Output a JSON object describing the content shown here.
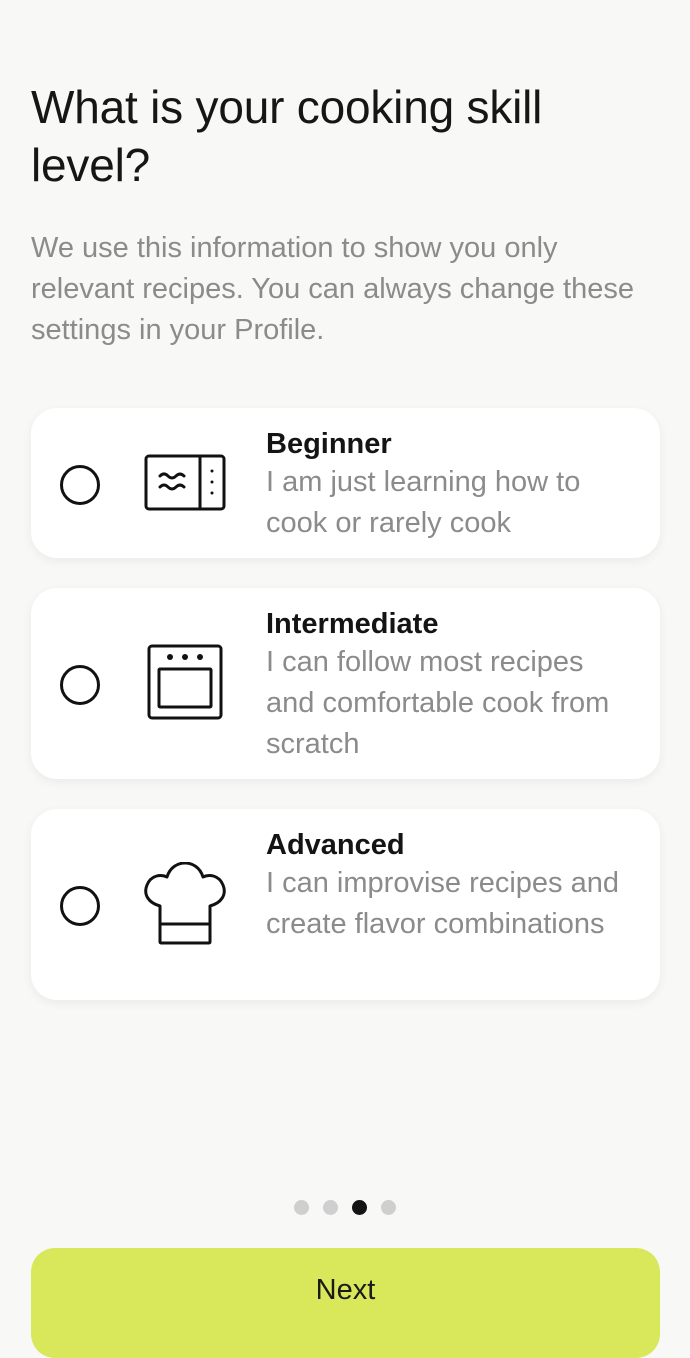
{
  "onboarding": {
    "title": "What is your cooking skill level?",
    "subtitle": "We use this information to show you only relevant recipes. You can always change these settings in your Profile.",
    "options": [
      {
        "label": "Beginner",
        "description": "I am just learning how to cook or rarely cook",
        "icon": "microwave-icon",
        "selected": false
      },
      {
        "label": "Intermediate",
        "description": "I can follow most recipes and comfortable cook from scratch",
        "icon": "oven-icon",
        "selected": false
      },
      {
        "label": "Advanced",
        "description": "I can improvise recipes and create flavor combinations",
        "icon": "chef-hat-icon",
        "selected": false
      }
    ],
    "pager": {
      "total_steps": 4,
      "current_step": 3
    },
    "next_button": {
      "label": "Next"
    }
  },
  "colors": {
    "background": "#f8f8f7",
    "card": "#ffffff",
    "accent": "#d9e75a",
    "text_primary": "#141414",
    "text_secondary": "#8b8b8b",
    "dot_inactive": "#cfcfcf",
    "dot_active": "#141414"
  }
}
